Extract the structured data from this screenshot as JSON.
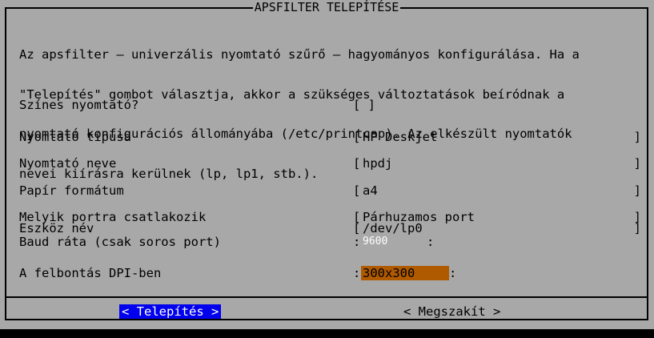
{
  "dialog": {
    "title": "APSFILTER TELEPÍTÉSE",
    "description": [
      "Az apsfilter – univerzális nyomtató szűrő – hagyományos konfigurálása. Ha a",
      "\"Telepítés\" gombot választja, akkor a szükséges változtatások beíródnak a",
      "nyomtató konfigurációs állományába (/etc/printcap). Az elkészült nyomtatók",
      "nevei kiírásra kerülnek (lp, lp1, stb.)."
    ]
  },
  "fields": {
    "color": {
      "label": "Színes nyomtató?",
      "checkbox": "[ ]"
    },
    "type": {
      "label": "Nyomtató típusa",
      "value": "HP Deskjet"
    },
    "name": {
      "label": "Nyomtató neve",
      "value": "hpdj"
    },
    "paper": {
      "label": "Papír formátum",
      "value": "a4"
    },
    "port": {
      "label": "Melyik portra csatlakozik",
      "value": "Párhuzamos port"
    },
    "device": {
      "label": "Eszköz név",
      "value": "/dev/lp0"
    },
    "baud": {
      "label": "Baud ráta (csak soros port)",
      "value": "9600"
    },
    "dpi": {
      "label": "A felbontás DPI-ben",
      "value": "300x300"
    }
  },
  "bracket": {
    "open": "[",
    "close": "]",
    "colon": ":"
  },
  "buttons": {
    "install": "< Telepítés >",
    "cancel": "< Megszakít >"
  },
  "colors": {
    "dialog_bg": "#a8a8a8",
    "focus_button_bg": "#0000ee",
    "active_input_bg": "#b05a00"
  }
}
